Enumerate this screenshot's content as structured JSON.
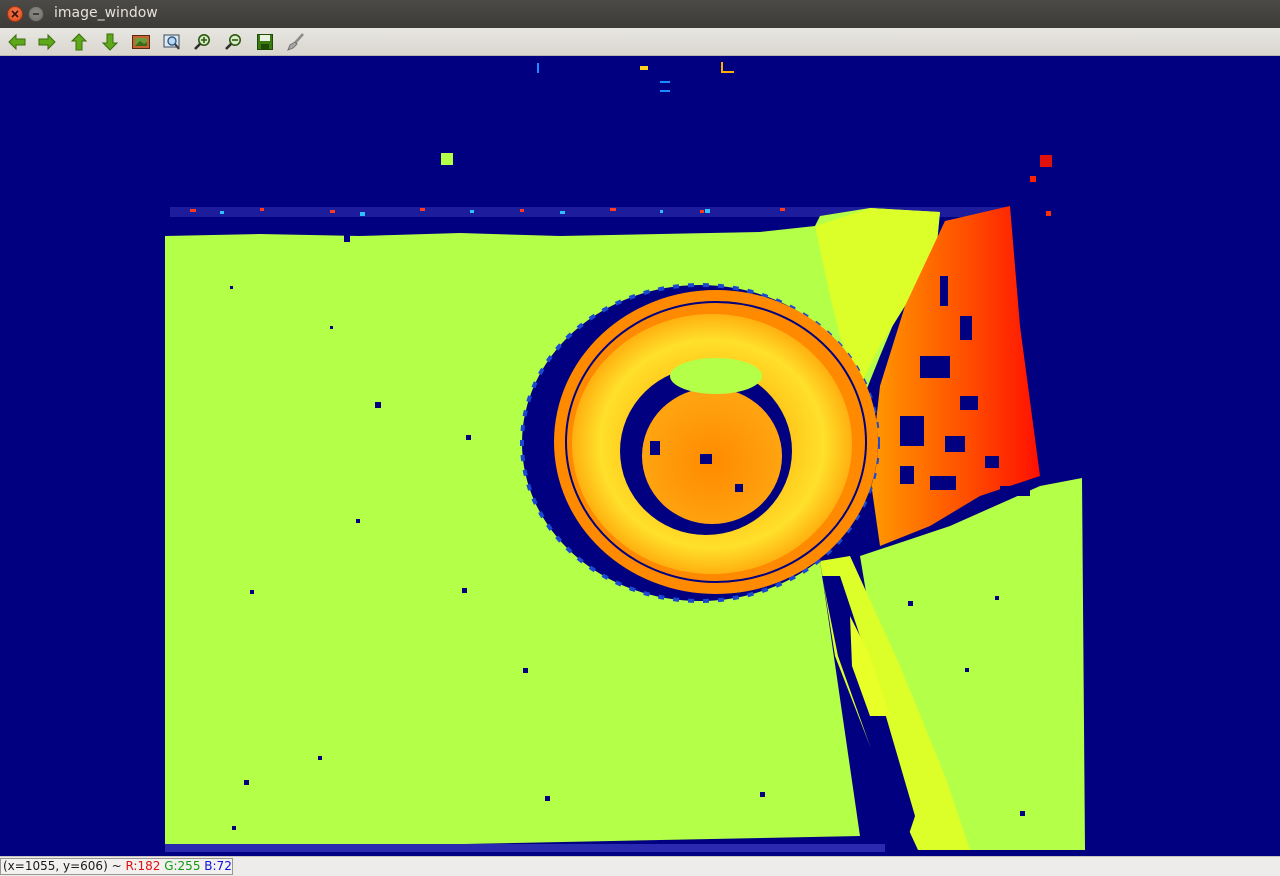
{
  "window": {
    "title": "image_window"
  },
  "toolbar": {
    "buttons": [
      {
        "icon": "arrow-left-icon",
        "color": "#4e9a06"
      },
      {
        "icon": "arrow-right-icon",
        "color": "#4e9a06"
      },
      {
        "icon": "arrow-up-icon",
        "color": "#4e9a06"
      },
      {
        "icon": "arrow-down-icon",
        "color": "#4e9a06"
      },
      {
        "icon": "image-icon"
      },
      {
        "icon": "zoom-fit-icon"
      },
      {
        "icon": "zoom-in-icon"
      },
      {
        "icon": "zoom-out-icon"
      },
      {
        "icon": "save-icon"
      },
      {
        "icon": "properties-brush-icon"
      }
    ]
  },
  "image": {
    "description_colors": {
      "background": "#000080",
      "plane": "#b4ff48",
      "ring_outer": "#ff8c00",
      "ring_inner": "#ffd21e",
      "hot": "#ff2000"
    }
  },
  "status": {
    "coord": "(x=1055, y=606) ~",
    "r": "R:182",
    "g": "G:255",
    "b": "B:72"
  }
}
